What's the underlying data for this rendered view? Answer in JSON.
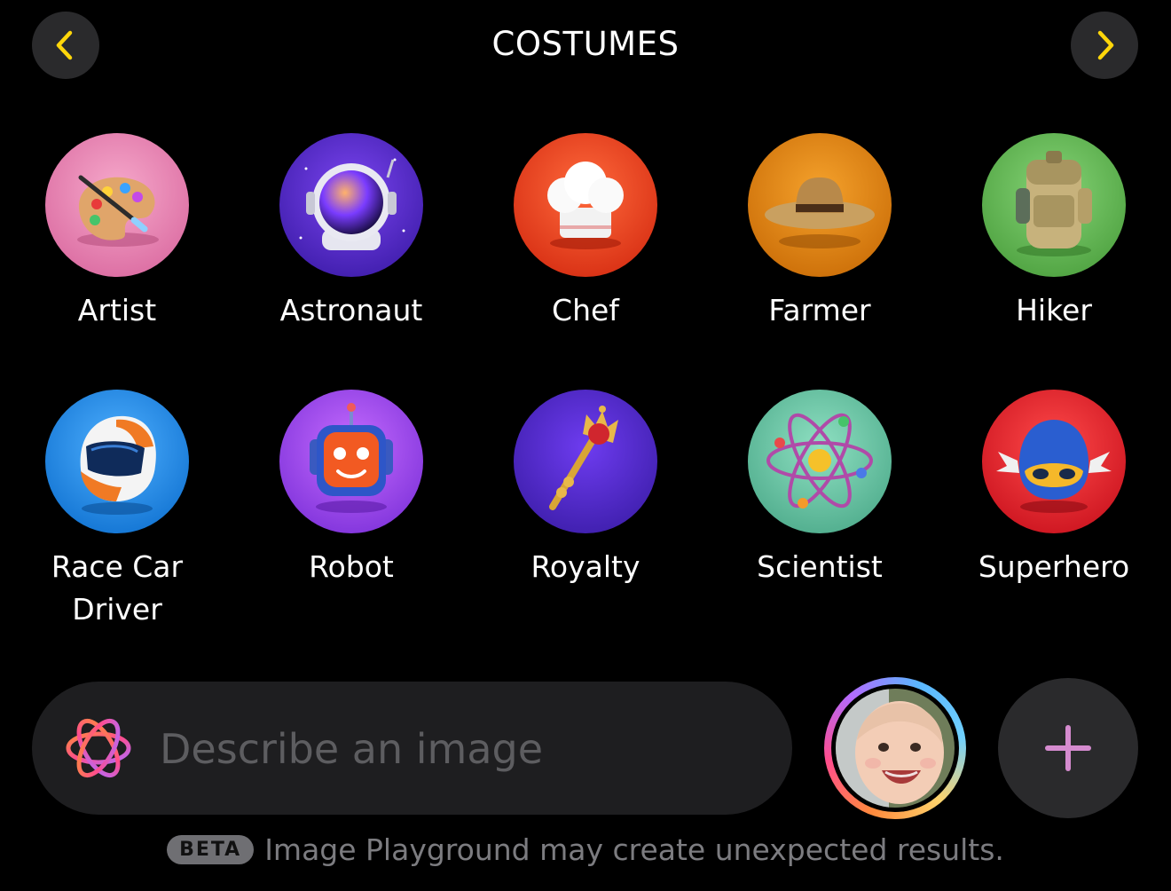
{
  "header": {
    "title": "COSTUMES",
    "prev_icon": "chevron-left-icon",
    "next_icon": "chevron-right-icon",
    "accent_color": "#ffd60a"
  },
  "costumes": [
    {
      "label": "Artist",
      "icon": "paint-palette-icon",
      "bg": "#e67fb0"
    },
    {
      "label": "Astronaut",
      "icon": "astronaut-helmet-icon",
      "bg": "#5a2cd6"
    },
    {
      "label": "Chef",
      "icon": "chef-hat-icon",
      "bg": "#ea3c1c"
    },
    {
      "label": "Farmer",
      "icon": "straw-hat-icon",
      "bg": "#e68a0f"
    },
    {
      "label": "Hiker",
      "icon": "backpack-icon",
      "bg": "#5bb24d"
    },
    {
      "label": "Race Car\nDriver",
      "icon": "racing-helmet-icon",
      "bg": "#1f8fe6"
    },
    {
      "label": "Robot",
      "icon": "robot-head-icon",
      "bg": "#a84de8"
    },
    {
      "label": "Royalty",
      "icon": "scepter-icon",
      "bg": "#4a26b8"
    },
    {
      "label": "Scientist",
      "icon": "atom-icon",
      "bg": "#6fc7a9"
    },
    {
      "label": "Superhero",
      "icon": "superhero-mask-icon",
      "bg": "#e0202c"
    }
  ],
  "prompt": {
    "placeholder": "Describe an image",
    "icon": "image-playground-icon"
  },
  "person": {
    "icon": "baby-photo-avatar"
  },
  "add_button": {
    "icon": "plus-icon",
    "color": "#d58bcf"
  },
  "footer": {
    "badge": "BETA",
    "text": "Image Playground may create unexpected results."
  }
}
